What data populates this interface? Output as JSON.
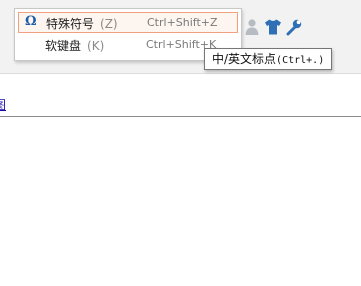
{
  "menu": {
    "items": [
      {
        "icon": "omega-icon",
        "glyph": "Ω",
        "label": "特殊符号",
        "key": "(Z)",
        "shortcut": "Ctrl+Shift+Z"
      },
      {
        "label": "软键盘",
        "key": "(K)",
        "shortcut": "Ctrl+Shift+K"
      }
    ]
  },
  "toolbar": {
    "icons": [
      "user-icon",
      "skin-shirt-icon",
      "settings-wrench-icon"
    ]
  },
  "tooltip": {
    "text": "中/英文标点",
    "shortcut": "(Ctrl+.)"
  },
  "page": {
    "link_fragment": "图"
  },
  "colors": {
    "accent": "#1f5da8",
    "highlight_border": "#f2a07e",
    "highlight_bg": "#fdf5ef"
  }
}
